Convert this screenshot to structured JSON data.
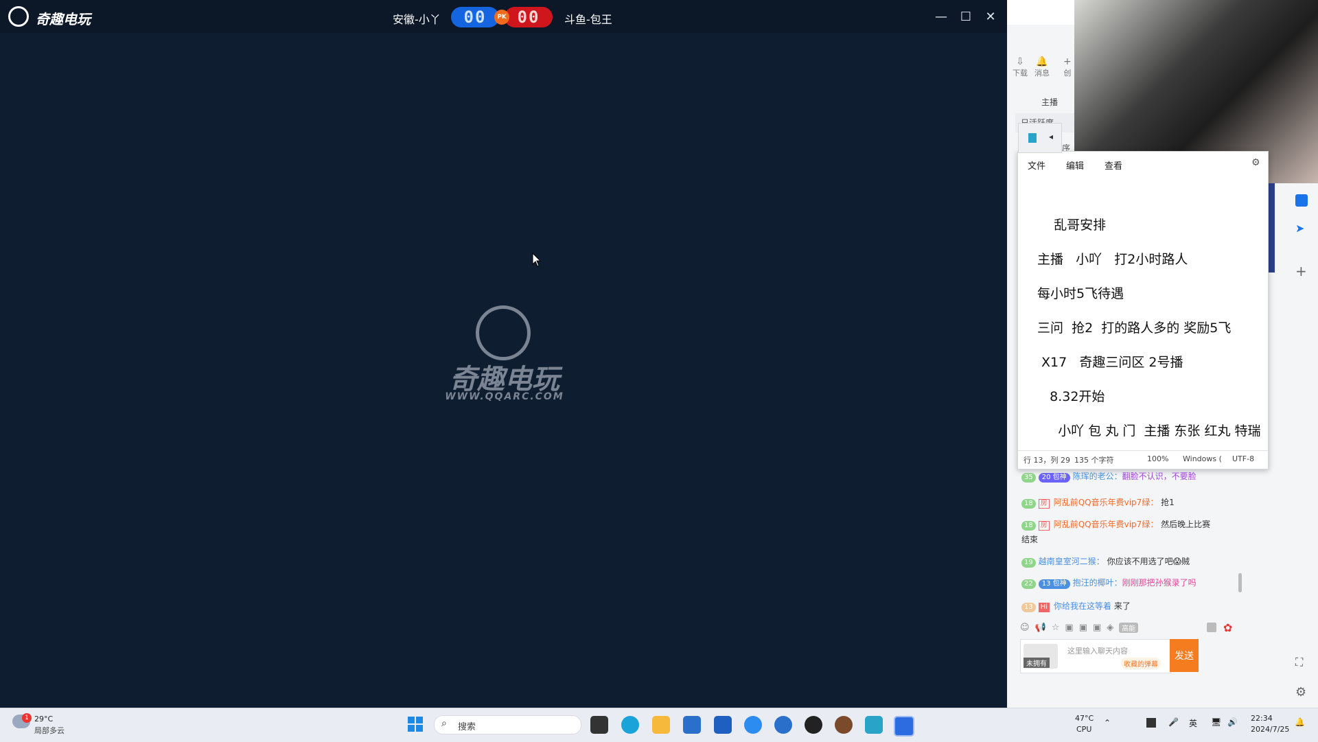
{
  "game_window": {
    "logo_text": "奇趣电玩",
    "left_player": "安徽-小丫",
    "right_player": "斗鱼-包王",
    "left_score": "00",
    "right_score": "00",
    "pk_label": "PK",
    "watermark_title": "奇趣电玩",
    "watermark_url": "WWW.QQARC.COM",
    "controls": {
      "minimize": "—",
      "maximize": "☐",
      "close": "✕"
    }
  },
  "side_panel": {
    "top_buttons": [
      {
        "label": "下载"
      },
      {
        "label": "消息"
      },
      {
        "label": "创"
      }
    ],
    "anchor_label": "主播",
    "tab_daily": "日活跃度",
    "tab_fans": "粉丝等级排序"
  },
  "notepad": {
    "menu": [
      "文件",
      "编辑",
      "查看"
    ],
    "lines": [
      "    乱哥安排",
      "主播   小吖   打2小时路人",
      "每小时5飞待遇",
      "三问  抢2  打的路人多的 奖励5飞",
      " X17   奇趣三问区 2号播",
      "   8.32开始",
      "     小吖 包 丸 门  主播 东张 红丸 特瑞"
    ],
    "status": {
      "pos": "行 13，列 29",
      "chars": "135 个字符",
      "zoom": "100%",
      "eol": "Windows (",
      "enc": "UTF-8"
    }
  },
  "chat": {
    "messages": [
      {
        "level": "35",
        "fan_level": "20",
        "fan_name": "包神",
        "user": "陈珲的老公：",
        "text": "翻脸不认识，不要脸"
      },
      {
        "level": "18",
        "room": "房",
        "user": "阿乱前QQ音乐年费vip7绿：",
        "text": "抢1"
      },
      {
        "level": "18",
        "room": "房",
        "user": "阿乱前QQ音乐年费vip7绿：",
        "text": "然后晚上比赛"
      },
      {
        "text": "结束"
      },
      {
        "level": "19",
        "user": "越南皇室河二猴：",
        "text": "你应该不用选了吧😱贼"
      },
      {
        "level": "22",
        "fan_level": "13",
        "fan_name": "包神",
        "user": "抱汪的椰叶：",
        "text": "刚刚那把孙猴录了吗"
      },
      {
        "level": "13",
        "room": "Hi",
        "user": "你给我在这等着",
        "text": "来了"
      }
    ],
    "tools": {
      "highlight": "高能"
    },
    "input_placeholder": "这里输入聊天内容",
    "fav_label": "收藏的弹幕",
    "send_label": "发送",
    "avatar_label": "未拥有"
  },
  "taskbar": {
    "weather_temp": "29°C",
    "weather_desc": "局部多云",
    "weather_badge": "1",
    "search_placeholder": "搜索",
    "cpu_temp": "47°C",
    "cpu_label": "CPU",
    "ime": "英",
    "time": "22:34",
    "date": "2024/7/25"
  }
}
